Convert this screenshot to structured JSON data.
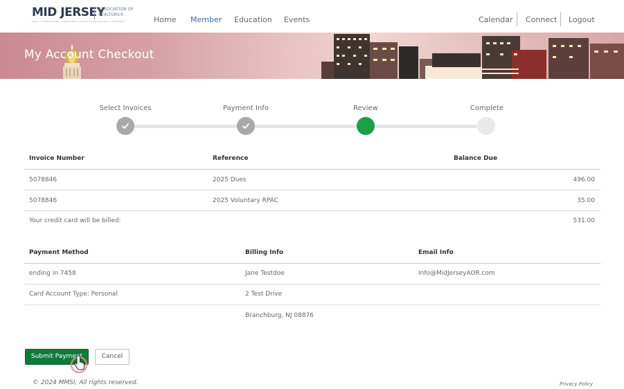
{
  "header": {
    "logo_brand": "MID JERSEY",
    "logo_association": "ASSOCIATION OF REALTORS®",
    "logo_tagline": "Merger of CSRE Association of REALTORS® and Island Central Association of REALTORS®",
    "nav_left": [
      "Home",
      "Member",
      "Education",
      "Events"
    ],
    "nav_right": [
      "Calendar",
      "Connect",
      "Logout"
    ],
    "active_nav": "Member"
  },
  "banner": {
    "title": "My Account Checkout"
  },
  "steps": [
    {
      "label": "Select Invoices",
      "state": "done"
    },
    {
      "label": "Payment Info",
      "state": "done"
    },
    {
      "label": "Review",
      "state": "current"
    },
    {
      "label": "Complete",
      "state": "todo"
    }
  ],
  "invoices": {
    "headers": {
      "number": "Invoice Number",
      "reference": "Reference",
      "balance": "Balance Due"
    },
    "rows": [
      {
        "number": "5078846",
        "reference": "2025 Dues",
        "balance": "496.00"
      },
      {
        "number": "5078846",
        "reference": "2025 Voluntary RPAC",
        "balance": "35.00"
      }
    ],
    "total_label": "Your credit card will be billed:",
    "total_value": "531.00"
  },
  "payment": {
    "headers": {
      "method": "Payment Method",
      "billing": "Billing Info",
      "email": "Email Info"
    },
    "method_lines": [
      "ending in 7458",
      "Card Account Type: Personal"
    ],
    "billing_lines": [
      "Jane Testdoe",
      "2 Test Drive",
      "Branchburg, NJ 08876"
    ],
    "email": "Info@MidJerseyAOR.com"
  },
  "actions": {
    "submit_label": "Submit Payment",
    "cancel_label": "Cancel"
  },
  "footer": {
    "copyright": "© 2024 MMSI, All rights reserved.",
    "privacy": "Privacy Policy"
  },
  "colors": {
    "accent_green": "#0e7a3a",
    "step_current": "#1a9f4a",
    "nav_active": "#3b6da3"
  }
}
